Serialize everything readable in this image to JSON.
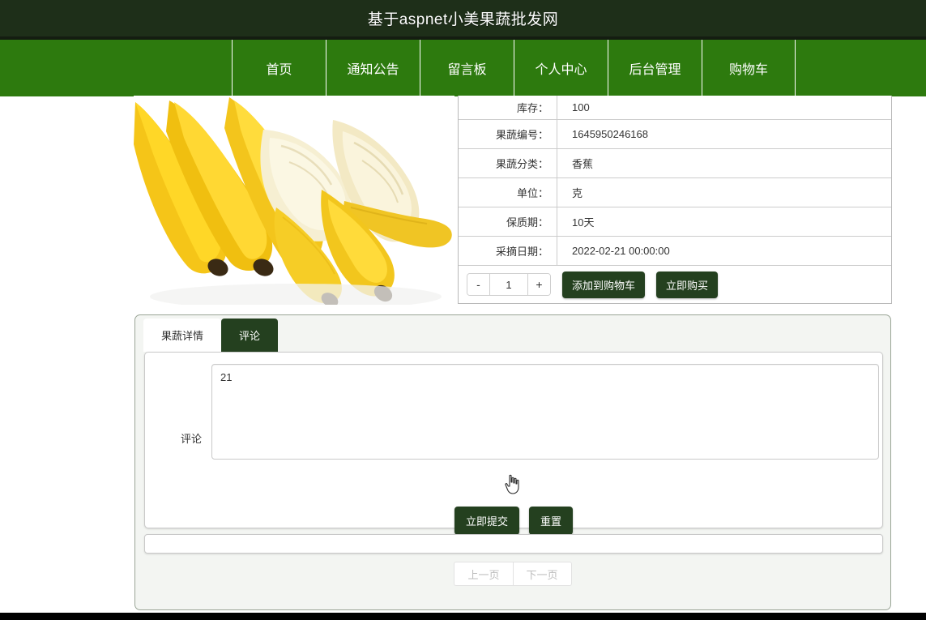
{
  "header": {
    "title": "基于aspnet小美果蔬批发网"
  },
  "nav": {
    "items": [
      {
        "label": "首页",
        "name": "nav-home"
      },
      {
        "label": "通知公告",
        "name": "nav-notice"
      },
      {
        "label": "留言板",
        "name": "nav-message-board"
      },
      {
        "label": "个人中心",
        "name": "nav-personal-center"
      },
      {
        "label": "后台管理",
        "name": "nav-admin"
      },
      {
        "label": "购物车",
        "name": "nav-cart"
      }
    ]
  },
  "product": {
    "image_alt": "香蕉",
    "specs": [
      {
        "label": "库存：",
        "value": "100"
      },
      {
        "label": "果蔬编号：",
        "value": "1645950246168"
      },
      {
        "label": "果蔬分类：",
        "value": "香蕉"
      },
      {
        "label": "单位：",
        "value": "克"
      },
      {
        "label": "保质期：",
        "value": "10天"
      },
      {
        "label": "采摘日期：",
        "value": "2022-02-21 00:00:00"
      }
    ],
    "quantity": {
      "decrement_label": "-",
      "value": "1",
      "increment_label": "+"
    },
    "add_to_cart_label": "添加到购物车",
    "buy_now_label": "立即购买"
  },
  "tabs": [
    {
      "label": "果蔬详情",
      "active": false
    },
    {
      "label": "评论",
      "active": true
    }
  ],
  "comment_form": {
    "field_label": "评论",
    "textarea_value": "21",
    "textarea_placeholder": "",
    "submit_label": "立即提交",
    "reset_label": "重置"
  },
  "pagination": {
    "prev_label": "上一页",
    "next_label": "下一页",
    "enabled": false
  },
  "colors": {
    "title_bar": "#1e2f19",
    "nav_bar": "#2d7a0e",
    "button_dark": "#24401f",
    "panel_bg": "#f3f5f2",
    "disabled_text": "#bdbdbd"
  }
}
